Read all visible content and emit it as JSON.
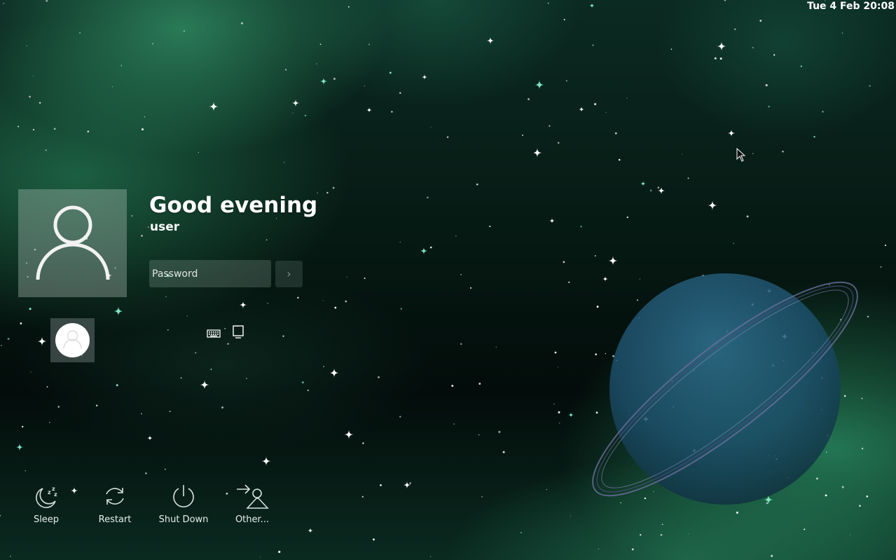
{
  "clock": {
    "text": "Tue 4 Feb 20:08"
  },
  "login": {
    "greeting": "Good evening",
    "username": "user",
    "password_placeholder": "Password",
    "submit_icon": "chevron-right-icon"
  },
  "toolbar": {
    "virtual_keyboard_icon": "keyboard-icon",
    "session_icon": "desktop-session-icon"
  },
  "power_actions": [
    {
      "id": "sleep",
      "label": "Sleep",
      "icon": "sleep-icon"
    },
    {
      "id": "restart",
      "label": "Restart",
      "icon": "restart-icon"
    },
    {
      "id": "shutdown",
      "label": "Shut Down",
      "icon": "power-icon"
    },
    {
      "id": "other",
      "label": "Other...",
      "icon": "switch-user-icon"
    }
  ],
  "colors": {
    "text": "#ffffff",
    "background_dark": "#061812",
    "aurora_green": "#2e9a6a",
    "field_background": "#96afa5"
  }
}
